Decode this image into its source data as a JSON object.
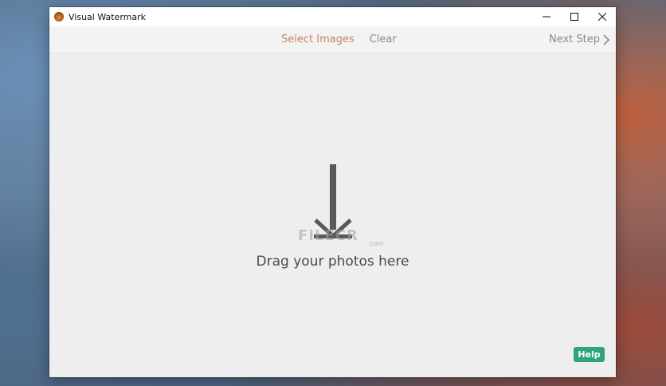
{
  "window": {
    "title": "Visual Watermark"
  },
  "toolbar": {
    "select_images_label": "Select Images",
    "clear_label": "Clear",
    "next_step_label": "Next Step"
  },
  "dropzone": {
    "message": "Drag your photos here",
    "watermark_text": "FILECR",
    "watermark_suffix": ".com"
  },
  "help": {
    "label": "Help"
  },
  "colors": {
    "accent_select": "#c5865a",
    "muted_text": "#8a8a8a",
    "help_button": "#2fa37a",
    "arrow": "#595959"
  },
  "icons": {
    "app": "visual-watermark-app-icon",
    "minimize": "minimize-icon",
    "maximize": "maximize-icon",
    "close": "close-icon",
    "next": "chevron-right-icon",
    "drop": "download-arrow-icon"
  }
}
